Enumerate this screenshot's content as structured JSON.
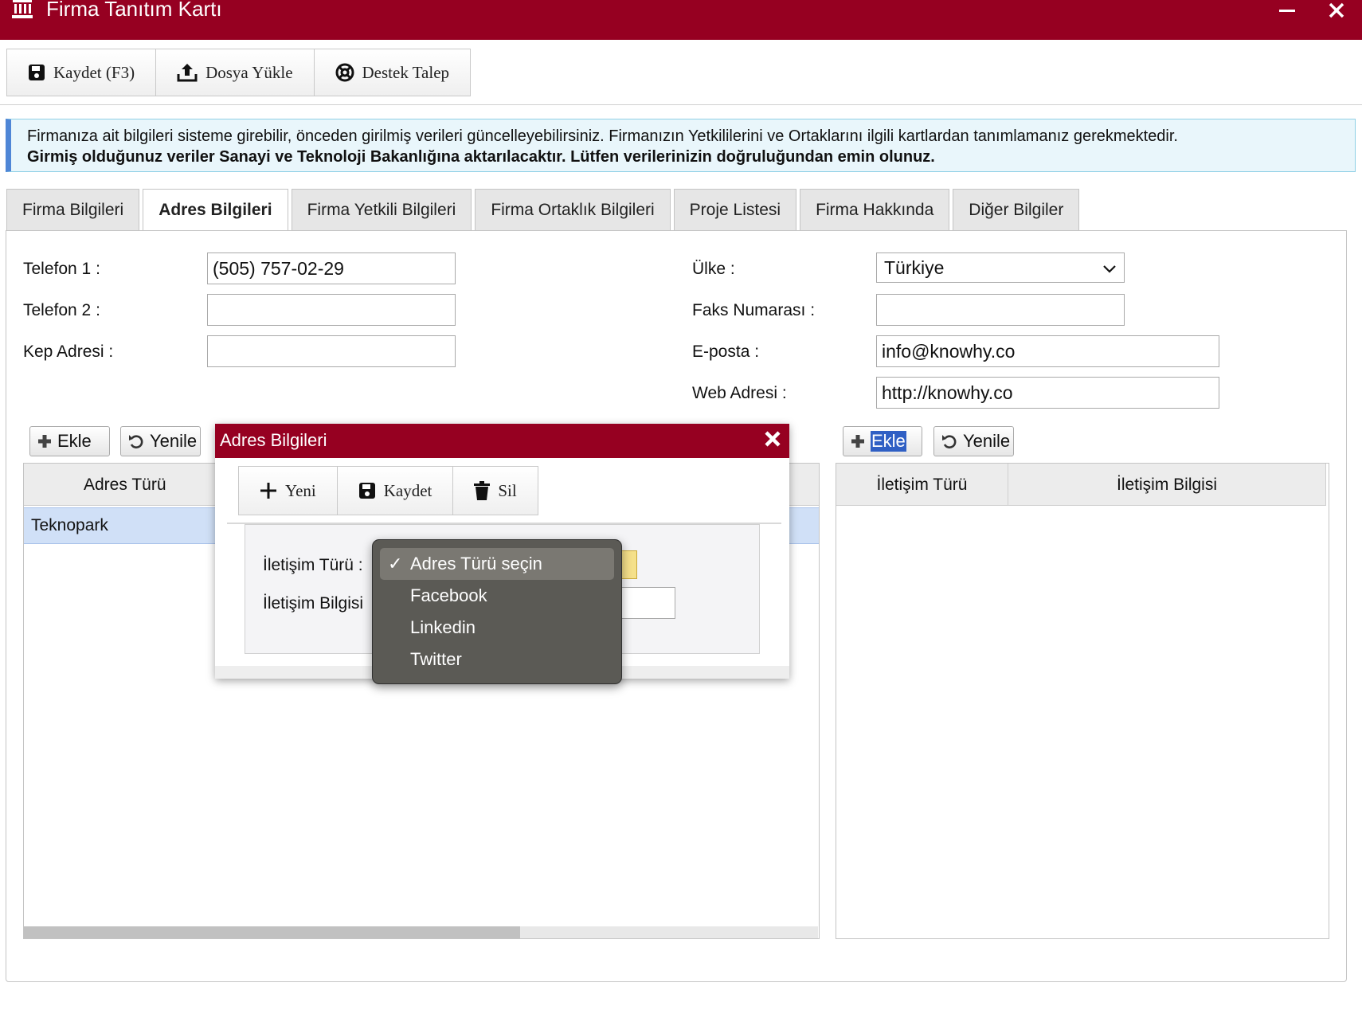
{
  "window": {
    "title": "Firma Tanıtım Kartı",
    "minimize_icon": "minus-icon",
    "close_icon": "close-icon",
    "brand_color": "#960021"
  },
  "toolbar": {
    "save_label": "Kaydet (F3)",
    "upload_label": "Dosya Yükle",
    "support_label": "Destek Talep"
  },
  "info": {
    "line1": "Firmanıza ait bilgileri sisteme girebilir, önceden girilmiş verileri güncelleyebilirsiniz. Firmanızın Yetkililerini ve Ortaklarını ilgili kartlardan tanımlamanız gerekmektedir.",
    "line2": "Girmiş olduğunuz veriler Sanayi ve Teknoloji Bakanlığına aktarılacaktır. Lütfen verilerinizin doğruluğundan emin olunuz."
  },
  "tabs": [
    {
      "label": "Firma Bilgileri"
    },
    {
      "label": "Adres Bilgileri",
      "active": true
    },
    {
      "label": "Firma Yetkili Bilgileri"
    },
    {
      "label": "Firma Ortaklık Bilgileri"
    },
    {
      "label": "Proje Listesi"
    },
    {
      "label": "Firma Hakkında"
    },
    {
      "label": "Diğer Bilgiler"
    }
  ],
  "form": {
    "phone1_label": "Telefon 1 :",
    "phone1_value": "(505) 757-02-29",
    "phone2_label": "Telefon 2 :",
    "phone2_value": "",
    "kep_label": "Kep Adresi :",
    "kep_value": "",
    "country_label": "Ülke :",
    "country_value": "Türkiye",
    "fax_label": "Faks Numarası :",
    "fax_value": "",
    "email_label": "E-posta :",
    "email_value": "info@knowhy.co",
    "web_label": "Web Adresi :",
    "web_value": "http://knowhy.co"
  },
  "address_grid": {
    "add_label": "Ekle",
    "refresh_label": "Yenile",
    "column": "Adres Türü",
    "rows": [
      "Teknopark"
    ]
  },
  "contact_grid": {
    "add_label": "Ekle",
    "refresh_label": "Yenile",
    "columns": [
      "İletişim Türü",
      "İletişim Bilgisi"
    ]
  },
  "modal": {
    "title": "Adres Bilgileri",
    "new_label": "Yeni",
    "save_label": "Kaydet",
    "delete_label": "Sil",
    "type_label": "İletişim Türü :",
    "info_label": "İletişim Bilgisi"
  },
  "dropdown": {
    "options": [
      "Adres Türü seçin",
      "Facebook",
      "Linkedin",
      "Twitter"
    ],
    "selected": "Adres Türü seçin"
  }
}
